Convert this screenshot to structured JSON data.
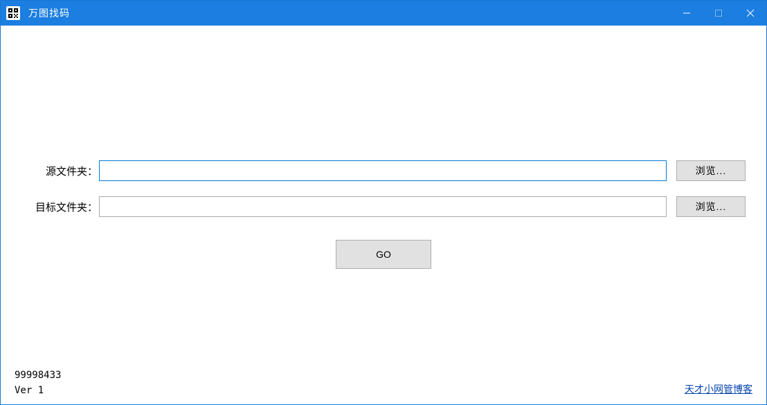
{
  "window": {
    "title": "万图找码"
  },
  "form": {
    "source_label": "源文件夹：",
    "source_value": "",
    "target_label": "目标文件夹：",
    "target_value": "",
    "browse_label": "浏览...",
    "go_label": "GO"
  },
  "status": {
    "number": "99998433",
    "version": "Ver  1"
  },
  "link": {
    "blog_text": "天才小网管博客"
  }
}
